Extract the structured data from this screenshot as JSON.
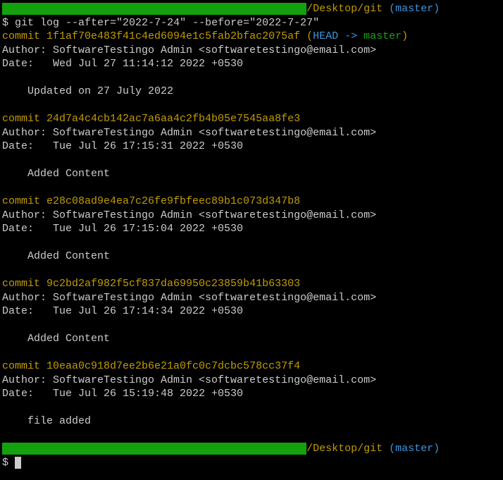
{
  "prompt1": {
    "path": "/Desktop/git",
    "branch": "(master)",
    "symbol": "$",
    "command": "git log --after=\"2022-7-24\" --before=\"2022-7-27\""
  },
  "commits": [
    {
      "hash": "1f1af70e483f41c4ed6094e1c5fab2bfac2075af",
      "refs": "(HEAD -> master)",
      "author": "SoftwareTestingo Admin <softwaretestingo@email.com>",
      "date": "Wed Jul 27 11:14:12 2022 +0530",
      "message": "Updated on 27 July 2022"
    },
    {
      "hash": "24d7a4c4cb142ac7a6aa4c2fb4b05e7545aa8fe3",
      "refs": "",
      "author": "SoftwareTestingo Admin <softwaretestingo@email.com>",
      "date": "Tue Jul 26 17:15:31 2022 +0530",
      "message": "Added Content"
    },
    {
      "hash": "e28c08ad9e4ea7c26fe9fbfeec89b1c073d347b8",
      "refs": "",
      "author": "SoftwareTestingo Admin <softwaretestingo@email.com>",
      "date": "Tue Jul 26 17:15:04 2022 +0530",
      "message": "Added Content"
    },
    {
      "hash": "9c2bd2af982f5cf837da69950c23859b41b63303",
      "refs": "",
      "author": "SoftwareTestingo Admin <softwaretestingo@email.com>",
      "date": "Tue Jul 26 17:14:34 2022 +0530",
      "message": "Added Content"
    },
    {
      "hash": "10eaa0c918d7ee2b6e21a0fc0c7dcbc578cc37f4",
      "refs": "",
      "author": "SoftwareTestingo Admin <softwaretestingo@email.com>",
      "date": "Tue Jul 26 15:19:48 2022 +0530",
      "message": "file added"
    }
  ],
  "prompt2": {
    "path": "/Desktop/git",
    "branch": "(master)",
    "symbol": "$"
  }
}
